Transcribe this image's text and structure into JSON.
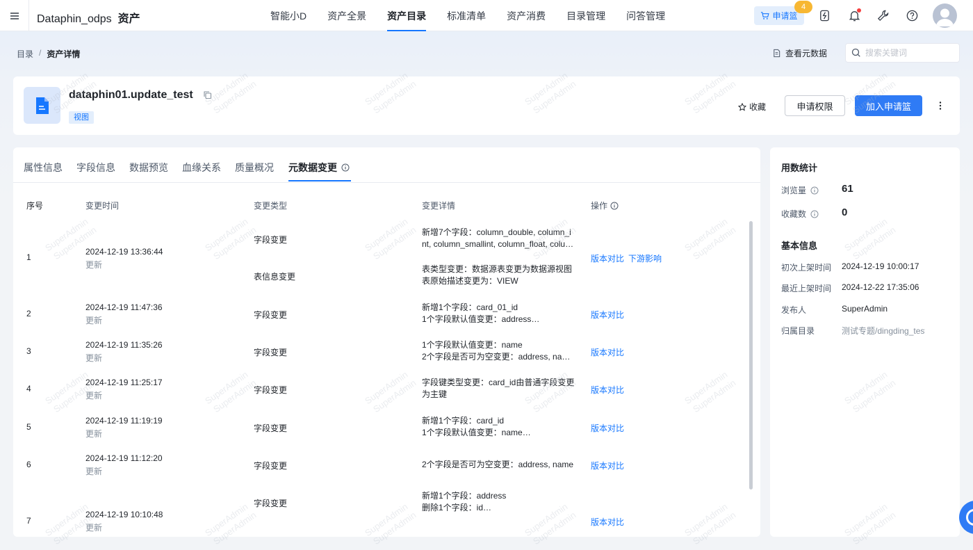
{
  "app": {
    "title": "Dataphin_odps",
    "subtitle": "资产"
  },
  "nav": [
    "智能小D",
    "资产全景",
    "资产目录",
    "标准清单",
    "资产消费",
    "目录管理",
    "问答管理"
  ],
  "nav_active_index": 2,
  "toolbar": {
    "cart_label": "申请篮",
    "cart_count": "4"
  },
  "breadcrumb": {
    "root": "目录",
    "sep": "/",
    "current": "资产详情"
  },
  "view_metadata_label": "查看元数据",
  "search": {
    "placeholder": "搜索关键词"
  },
  "asset": {
    "name": "dataphin01.update_test",
    "tag": "视图"
  },
  "actions": {
    "favorite": "收藏",
    "apply_permission": "申请权限",
    "add_to_basket": "加入申请篮"
  },
  "tabs": [
    "属性信息",
    "字段信息",
    "数据预览",
    "血缘关系",
    "质量概况",
    "元数据变更"
  ],
  "table": {
    "headers": {
      "index": "序号",
      "time": "变更时间",
      "type": "变更类型",
      "detail": "变更详情",
      "action": "操作"
    },
    "rows": [
      {
        "index": "1",
        "time": "2024-12-19 13:36:44",
        "sub": "更新",
        "changes": [
          {
            "type": "字段变更",
            "lines": [
              "新增7个字段：column_double, column_i",
              "nt, column_smallint, column_float, colu…"
            ]
          },
          {
            "type": "表信息变更",
            "lines": [
              "表类型变更：数据源表变更为数据源视图",
              "表原始描述变更为：VIEW"
            ]
          }
        ],
        "actions": [
          "版本对比",
          "下游影响"
        ]
      },
      {
        "index": "2",
        "time": "2024-12-19 11:47:36",
        "sub": "更新",
        "changes": [
          {
            "type": "字段变更",
            "lines": [
              "新增1个字段：card_01_id",
              "1个字段默认值变更：address…"
            ]
          }
        ],
        "actions": [
          "版本对比"
        ]
      },
      {
        "index": "3",
        "time": "2024-12-19 11:35:26",
        "sub": "更新",
        "changes": [
          {
            "type": "字段变更",
            "lines": [
              "1个字段默认值变更：name",
              "2个字段是否可为空变更：address, na…"
            ]
          }
        ],
        "actions": [
          "版本对比"
        ]
      },
      {
        "index": "4",
        "time": "2024-12-19 11:25:17",
        "sub": "更新",
        "changes": [
          {
            "type": "字段变更",
            "lines": [
              "字段键类型变更：card_id由普通字段变更",
              "为主键"
            ]
          }
        ],
        "actions": [
          "版本对比"
        ]
      },
      {
        "index": "5",
        "time": "2024-12-19 11:19:19",
        "sub": "更新",
        "changes": [
          {
            "type": "字段变更",
            "lines": [
              "新增1个字段：card_id",
              "1个字段默认值变更：name…"
            ]
          }
        ],
        "actions": [
          "版本对比"
        ]
      },
      {
        "index": "6",
        "time": "2024-12-19 11:12:20",
        "sub": "更新",
        "changes": [
          {
            "type": "字段变更",
            "lines": [
              "2个字段是否可为空变更：address, name"
            ]
          }
        ],
        "actions": [
          "版本对比"
        ]
      },
      {
        "index": "7",
        "time": "2024-12-19 10:10:48",
        "sub": "更新",
        "changes": [
          {
            "type": "字段变更",
            "lines": [
              "新增1个字段：address",
              "删除1个字段：id…"
            ]
          }
        ],
        "actions": [
          "版本对比"
        ]
      }
    ]
  },
  "usage": {
    "title": "用数统计",
    "views_label": "浏览量",
    "views": "61",
    "favorites_label": "收藏数",
    "favorites": "0"
  },
  "basic": {
    "title": "基本信息",
    "first_listed_label": "初次上架时间",
    "first_listed": "2024-12-19 10:00:17",
    "last_listed_label": "最近上架时间",
    "last_listed": "2024-12-22 17:35:06",
    "publisher_label": "发布人",
    "publisher": "SuperAdmin",
    "catalog_label": "归属目录",
    "catalog": "测试专题/dingding_test"
  },
  "colors": {
    "primary": "#1677ff",
    "badge": "#f7b733",
    "notification": "#f53f3f"
  },
  "icons": [
    "menu-icon",
    "cart-icon",
    "bolt-icon",
    "bell-icon",
    "wrench-icon",
    "help-icon",
    "document-icon",
    "copy-icon",
    "star-icon",
    "more-icon",
    "search-icon",
    "info-icon"
  ],
  "watermark": "SuperAdmin"
}
